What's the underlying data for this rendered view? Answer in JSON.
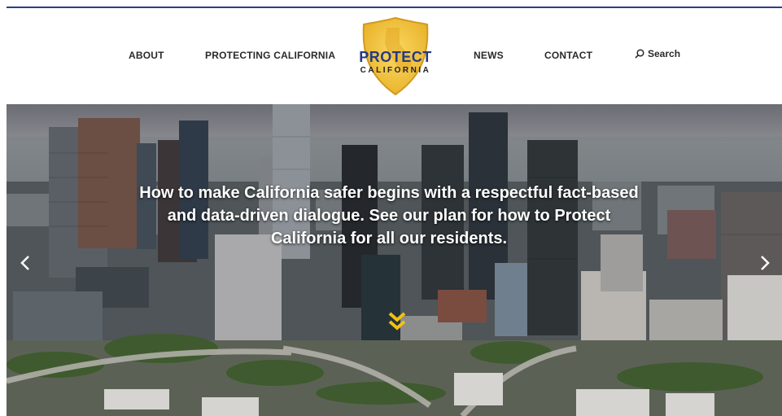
{
  "nav": {
    "about": "ABOUT",
    "protecting_california": "PROTECTING CALIFORNIA",
    "news": "NEWS",
    "contact": "CONTACT",
    "search": "Search"
  },
  "logo": {
    "line1": "PROTECT",
    "line2": "CALIFORNIA"
  },
  "hero": {
    "text": "How to make California safer begins with a respectful fact-based and data-driven dialogue. See our plan for how to Protect California for all our residents."
  },
  "icons": {
    "search": "search-icon",
    "prev": "chevron-left-icon",
    "next": "chevron-right-icon",
    "scroll": "double-chevron-down-icon"
  },
  "colors": {
    "brand_blue": "#243a86",
    "logo_gold": "#f2c43a",
    "scroll_cue": "#f1c10f"
  }
}
